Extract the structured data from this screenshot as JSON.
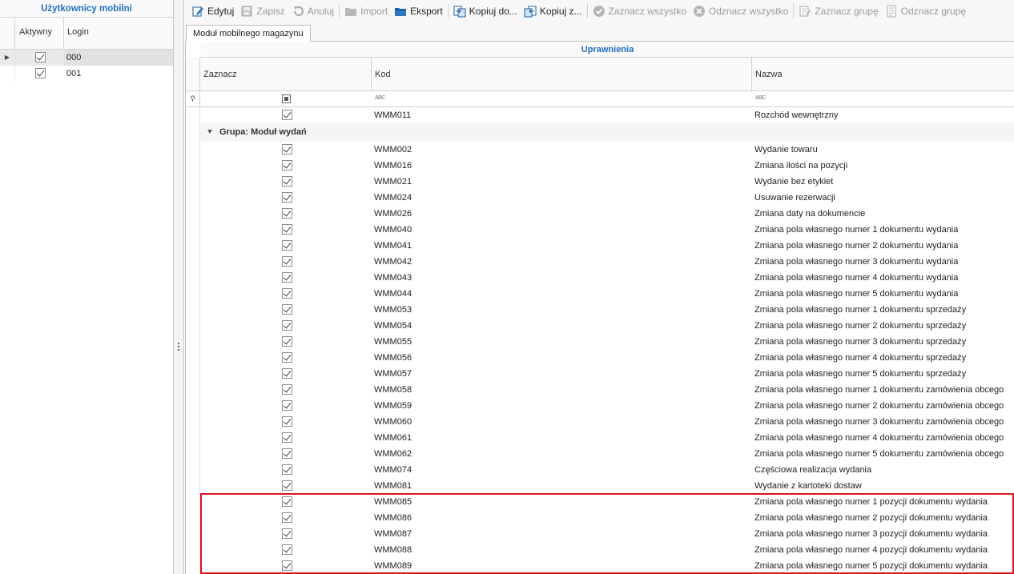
{
  "left_panel": {
    "title": "Użytkownicy mobilni",
    "columns": {
      "active": "Aktywny",
      "login": "Login"
    },
    "users": [
      {
        "login": "000",
        "active": true,
        "selected": true
      },
      {
        "login": "001",
        "active": true,
        "selected": false
      }
    ]
  },
  "toolbar": {
    "edit": "Edytuj",
    "save": "Zapisz",
    "cancel": "Anuluj",
    "import": "Import",
    "export": "Eksport",
    "copy_to": "Kopiuj do...",
    "copy_from": "Kopiuj z...",
    "select_all": "Zaznacz wszystko",
    "deselect_all": "Odznacz wszystko",
    "select_group": "Zaznacz grupę",
    "deselect_group": "Odznacz grupę"
  },
  "tab": {
    "label": "Moduł mobilnego magazynu"
  },
  "grid": {
    "band_title": "Uprawnienia",
    "columns": {
      "select": "Zaznacz",
      "code": "Kod",
      "name": "Nazwa"
    },
    "filter_text_icon": "ABC",
    "top_row": {
      "code": "WMM011",
      "name": "Rozchód wewnętrzny",
      "checked": true
    },
    "group_label": "Grupa: Moduł wydań",
    "rows": [
      {
        "code": "WMM002",
        "name": "Wydanie towaru",
        "checked": true
      },
      {
        "code": "WMM016",
        "name": "Zmiana ilości na pozycji",
        "checked": true
      },
      {
        "code": "WMM021",
        "name": "Wydanie bez etykiet",
        "checked": true
      },
      {
        "code": "WMM024",
        "name": "Usuwanie rezerwacji",
        "checked": true
      },
      {
        "code": "WMM026",
        "name": "Zmiana daty na dokumencie",
        "checked": true
      },
      {
        "code": "WMM040",
        "name": "Zmiana pola własnego numer 1 dokumentu wydania",
        "checked": true
      },
      {
        "code": "WMM041",
        "name": "Zmiana pola własnego numer 2 dokumentu wydania",
        "checked": true
      },
      {
        "code": "WMM042",
        "name": "Zmiana pola własnego numer 3 dokumentu wydania",
        "checked": true
      },
      {
        "code": "WMM043",
        "name": "Zmiana pola własnego numer 4 dokumentu wydania",
        "checked": true
      },
      {
        "code": "WMM044",
        "name": "Zmiana pola własnego numer 5 dokumentu wydania",
        "checked": true
      },
      {
        "code": "WMM053",
        "name": "Zmiana pola własnego numer 1 dokumentu sprzedaży",
        "checked": true
      },
      {
        "code": "WMM054",
        "name": "Zmiana pola własnego numer 2 dokumentu sprzedaży",
        "checked": true
      },
      {
        "code": "WMM055",
        "name": "Zmiana pola własnego numer 3 dokumentu sprzedaży",
        "checked": true
      },
      {
        "code": "WMM056",
        "name": "Zmiana pola własnego numer 4 dokumentu sprzedaży",
        "checked": true
      },
      {
        "code": "WMM057",
        "name": "Zmiana pola własnego numer 5 dokumentu sprzedaży",
        "checked": true
      },
      {
        "code": "WMM058",
        "name": "Zmiana pola własnego numer 1 dokumentu zamówienia obcego",
        "checked": true
      },
      {
        "code": "WMM059",
        "name": "Zmiana pola własnego numer 2 dokumentu zamówienia obcego",
        "checked": true
      },
      {
        "code": "WMM060",
        "name": "Zmiana pola własnego numer 3 dokumentu zamówienia obcego",
        "checked": true
      },
      {
        "code": "WMM061",
        "name": "Zmiana pola własnego numer 4 dokumentu zamówienia obcego",
        "checked": true
      },
      {
        "code": "WMM062",
        "name": "Zmiana pola własnego numer 5 dokumentu zamówienia obcego",
        "checked": true
      },
      {
        "code": "WMM074",
        "name": "Częściowa realizacja wydania",
        "checked": true
      },
      {
        "code": "WMM081",
        "name": "Wydanie z kartoteki dostaw",
        "checked": true
      },
      {
        "code": "WMM085",
        "name": "Zmiana pola własnego numer 1 pozycji dokumentu wydania",
        "checked": true
      },
      {
        "code": "WMM086",
        "name": "Zmiana pola własnego numer 2 pozycji dokumentu wydania",
        "checked": true
      },
      {
        "code": "WMM087",
        "name": "Zmiana pola własnego numer 3 pozycji dokumentu wydania",
        "checked": true
      },
      {
        "code": "WMM088",
        "name": "Zmiana pola własnego numer 4 pozycji dokumentu wydania",
        "checked": true
      },
      {
        "code": "WMM089",
        "name": "Zmiana pola własnego numer 5 pozycji dokumentu wydania",
        "checked": true
      }
    ]
  },
  "colors": {
    "accent": "#1e6fc0",
    "highlight": "#d9161d",
    "disabled": "#9a9a9a"
  }
}
